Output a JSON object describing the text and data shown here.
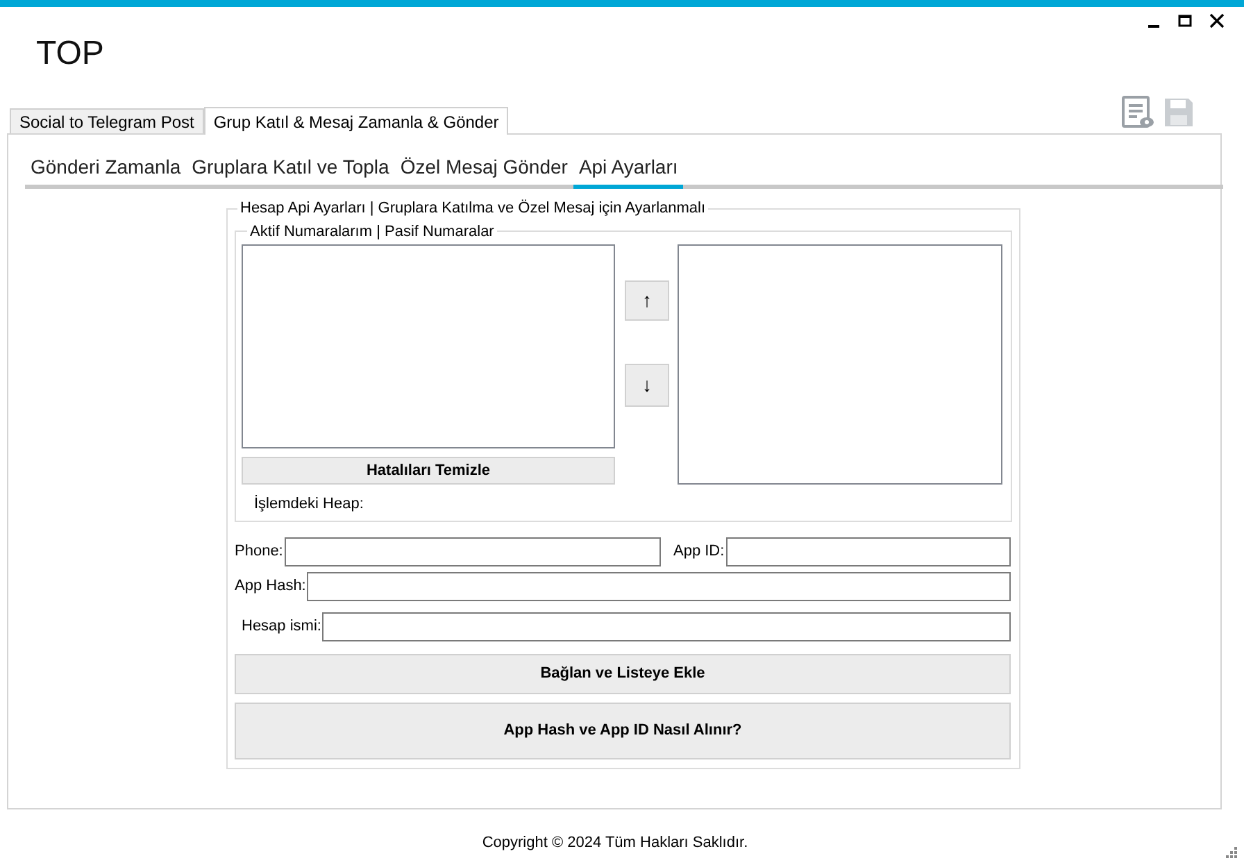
{
  "window": {
    "title": "TOP"
  },
  "outer_tabs": [
    {
      "label": "Social to Telegram Post",
      "selected": false
    },
    {
      "label": "Grup Katıl & Mesaj Zamanla & Gönder",
      "selected": true
    }
  ],
  "inner_tabs": [
    {
      "label": "Gönderi Zamanla",
      "selected": false
    },
    {
      "label": "Gruplara Katıl ve Topla",
      "selected": false
    },
    {
      "label": "Özel Mesaj Gönder",
      "selected": false
    },
    {
      "label": "Api Ayarları",
      "selected": true
    }
  ],
  "api_group": {
    "title": "Hesap Api Ayarları | Gruplara Katılma ve Özel Mesaj için Ayarlanmalı",
    "numbers_group": {
      "title": "Aktif Numaralarım | Pasif Numaralar",
      "move_up": "↑",
      "move_down": "↓",
      "clear_button": "Hatalıları Temizle",
      "heap_label": "İşlemdeki Heap:"
    },
    "phone": {
      "label": "Phone:"
    },
    "app_id": {
      "label": "App ID:"
    },
    "app_hash": {
      "label": "App Hash:"
    },
    "account_name": {
      "label": "Hesap ismi:"
    },
    "connect_button": "Bağlan ve Listeye Ekle",
    "help_button": "App Hash ve App ID Nasıl Alınır?"
  },
  "footer": "Copyright © 2024 Tüm Hakları Saklıdır."
}
